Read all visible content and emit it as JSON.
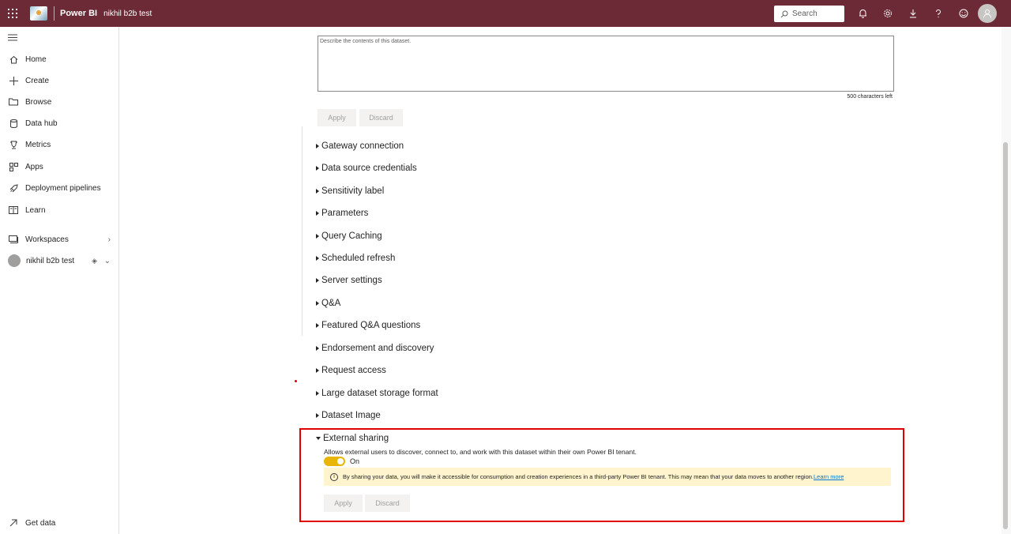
{
  "topbar": {
    "brand": "Power BI",
    "workspace": "nikhil b2b test",
    "search_placeholder": "Search"
  },
  "nav": {
    "items": [
      {
        "label": "Home",
        "icon": "home-icon"
      },
      {
        "label": "Create",
        "icon": "plus-icon"
      },
      {
        "label": "Browse",
        "icon": "folder-icon"
      },
      {
        "label": "Data hub",
        "icon": "database-icon"
      },
      {
        "label": "Metrics",
        "icon": "trophy-icon"
      },
      {
        "label": "Apps",
        "icon": "apps-icon"
      },
      {
        "label": "Deployment pipelines",
        "icon": "rocket-icon"
      },
      {
        "label": "Learn",
        "icon": "book-icon"
      }
    ],
    "workspaces_label": "Workspaces",
    "current_workspace": "nikhil b2b test",
    "get_data_label": "Get data"
  },
  "description": {
    "placeholder": "Describe the contents of this dataset.",
    "chars_left": "500 characters left",
    "apply": "Apply",
    "discard": "Discard"
  },
  "sections": [
    "Gateway connection",
    "Data source credentials",
    "Sensitivity label",
    "Parameters",
    "Query Caching",
    "Scheduled refresh",
    "Server settings",
    "Q&A",
    "Featured Q&A questions",
    "Endorsement and discovery",
    "Request access",
    "Large dataset storage format",
    "Dataset Image"
  ],
  "external_sharing": {
    "title": "External sharing",
    "description": "Allows external users to discover, connect to, and work with this dataset within their own Power BI tenant.",
    "toggle_label": "On",
    "warning": "By sharing your data, you will make it accessible for consumption and creation experiences in a third-party Power BI tenant. This may mean that your data moves to another region.",
    "learn_more": "Learn more",
    "apply": "Apply",
    "discard": "Discard"
  },
  "colors": {
    "topbar": "#6b2a35",
    "toggle_on": "#e8b600",
    "highlight": "#e00000",
    "warning_bg": "#fff4ce"
  }
}
